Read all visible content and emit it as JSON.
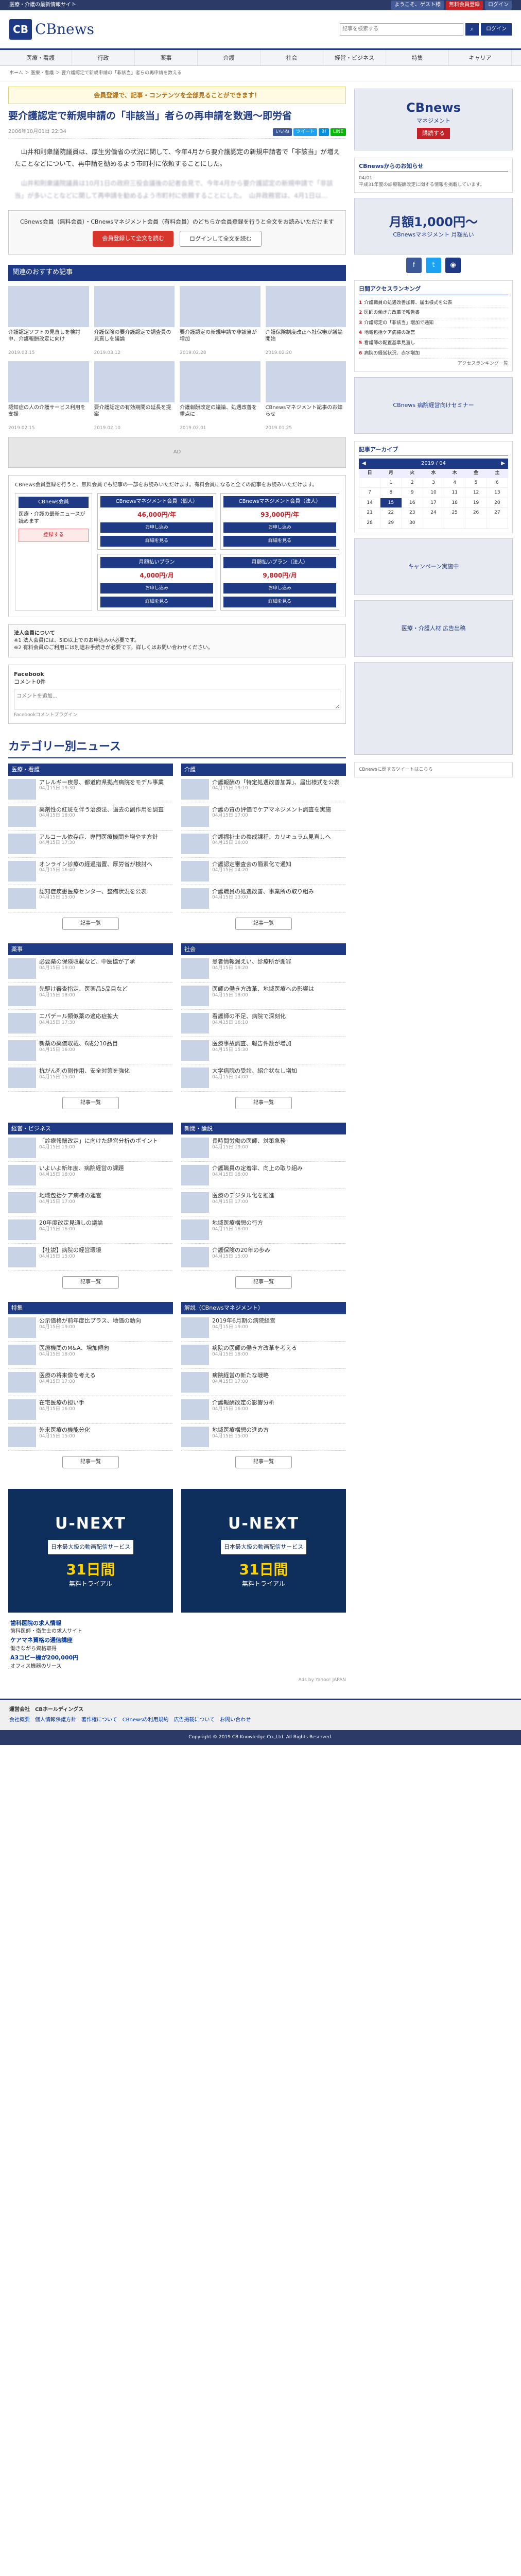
{
  "topbar": {
    "left": "医療・介護の最新情報サイト",
    "links": [
      "ようこそ、ゲスト様",
      "無料会員登録",
      "ログイン"
    ]
  },
  "header": {
    "logo_mark": "CB",
    "logo_text": "CBnews",
    "search_placeholder": "記事を検索する",
    "login_label": "ログイン"
  },
  "gnav": [
    "医療・看護",
    "行政",
    "薬事",
    "介護",
    "社会",
    "経営・ビジネス",
    "特集",
    "キャリア"
  ],
  "breadcrumb": "ホーム ＞ 医療・看護 ＞ 要介護認定で新規申請の「非該当」者らの再申請を数える",
  "banner": "会員登録で、記事・コンテンツを全部見ることができます！",
  "article": {
    "title": "要介護認定で新規申請の「非該当」者らの再申請を数週～即労省",
    "date": "2006年10月01日 22:34",
    "sns": [
      "いいね",
      "ツイート",
      "B!",
      "LINE"
    ],
    "paragraphs": [
      "　山井和則衆議院議員は、厚生労働省の状況に関して、今年4月から要介護認定の新規申請者で「非該当」が増えたことなどについて、再申請を勧めるよう市町村に依頼することにした。",
      "　山井和則衆議院議員は10月1日の政府三役会議後の記者会見で、今年4月から要介護認定の新規申請で「非該当」が多いことなどに関して再申請を勧めるよう市町村に依頼することにした。　山井政務官は、4月1日以…"
    ],
    "register": {
      "note": "CBnews会員（無料会員）・CBnewsマネジメント会員（有料会員）のどちらか会員登録を行うと全文をお読みいただけます",
      "btn1": "会員登録して全文を読む",
      "btn2": "ログインして全文を読む"
    }
  },
  "recommend": {
    "heading": "関連のおすすめ記事",
    "items": [
      {
        "t": "介護認定ソフトの見直しを検討中、介護報酬改定に向け",
        "d": "2019.03.15"
      },
      {
        "t": "介護保険の要介護認定で調査員の見直しを議論",
        "d": "2019.03.12"
      },
      {
        "t": "要介護認定の新規申請で非該当が増加",
        "d": "2019.02.28"
      },
      {
        "t": "介護保険制度改正へ社保審が議論開始",
        "d": "2019.02.20"
      },
      {
        "t": "認知症の人の介護サービス利用を支援",
        "d": "2019.02.15"
      },
      {
        "t": "要介護認定の有効期間の延長を提案",
        "d": "2019.02.10"
      },
      {
        "t": "介護報酬改定の議論、処遇改善を重点に",
        "d": "2019.02.01"
      },
      {
        "t": "CBnewsマネジメント記事のお知らせ",
        "d": "2019.01.25"
      }
    ]
  },
  "plans": {
    "intro": "CBnews会員登録を行うと、無料会員でも記事の一部をお読みいただけます。有料会員になると全ての記事をお読みいただけます。",
    "free": {
      "title": "CBnews会員",
      "note": "医療・介護の最新ニュースが読めます",
      "btn": "登録する"
    },
    "items": [
      {
        "title": "CBnewsマネジメント会員（個人）",
        "price": "46,000円/年",
        "btn": "お申し込み"
      },
      {
        "title": "CBnewsマネジメント会員（法人）",
        "price": "93,000円/年",
        "btn": "お申し込み"
      },
      {
        "title": "月額払いプラン",
        "price": "4,000円/月",
        "btn": "お申し込み"
      },
      {
        "title": "月額払いプラン（法人）",
        "price": "9,800円/月",
        "btn": "お申し込み"
      }
    ],
    "detail_btn": "詳細を見る"
  },
  "notes": {
    "title": "法人会員について",
    "lines": [
      "※1 法人会員には、5ID以上でのお申込みが必要です。",
      "※2 有料会員のご利用には別途お手続きが必要です。詳しくはお問い合わせください。"
    ]
  },
  "facebook": {
    "title": "Facebook",
    "count": "コメント0件",
    "placeholder": "コメントを追加...",
    "plugin": "Facebookコメントプラグイン"
  },
  "categories": {
    "heading": "カテゴリー別ニュース",
    "more": "記事一覧",
    "boxes": [
      {
        "name": "医療・看護",
        "items": [
          {
            "t": "アレルギー疾患、都道府県拠点病院をモデル事業",
            "d": "04月15日 19:30"
          },
          {
            "t": "薬剤性の紅斑を伴う治療法、過去の副作用を調査",
            "d": "04月15日 18:00"
          },
          {
            "t": "アルコール依存症、専門医療機関を増やす方針",
            "d": "04月15日 17:30"
          },
          {
            "t": "オンライン診療の経過措置、厚労省が検討へ",
            "d": "04月15日 16:40"
          },
          {
            "t": "認知症疾患医療センター、整備状況を公表",
            "d": "04月15日 15:00"
          }
        ]
      },
      {
        "name": "介護",
        "items": [
          {
            "t": "介護報酬の「特定処遇改善加算」、届出様式を公表",
            "d": "04月15日 19:10"
          },
          {
            "t": "介護の質の評価でケアマネジメント調査を実施",
            "d": "04月15日 17:00"
          },
          {
            "t": "介護福祉士の養成課程、カリキュラム見直しへ",
            "d": "04月15日 16:00"
          },
          {
            "t": "介護認定審査会の簡素化で通知",
            "d": "04月15日 14:20"
          },
          {
            "t": "介護職員の処遇改善、事業所の取り組み",
            "d": "04月15日 13:00"
          }
        ]
      },
      {
        "name": "薬事",
        "items": [
          {
            "t": "必要薬の保険収載など、中医協が了承",
            "d": "04月15日 19:00"
          },
          {
            "t": "先駆け審査指定、医薬品5品目など",
            "d": "04月15日 18:00"
          },
          {
            "t": "エパデール類似薬の適応症拡大",
            "d": "04月15日 17:30"
          },
          {
            "t": "新薬の薬価収載、6成分10品目",
            "d": "04月15日 16:00"
          },
          {
            "t": "抗がん剤の副作用、安全対策を強化",
            "d": "04月15日 15:00"
          }
        ]
      },
      {
        "name": "社会",
        "items": [
          {
            "t": "患者情報漏えい、診療所が謝罪",
            "d": "04月15日 19:20"
          },
          {
            "t": "医師の働き方改革、地域医療への影響は",
            "d": "04月15日 18:00"
          },
          {
            "t": "看護師の不足、病院で深刻化",
            "d": "04月15日 16:10"
          },
          {
            "t": "医療事故調査、報告件数が増加",
            "d": "04月15日 15:30"
          },
          {
            "t": "大学病院の受診、紹介状なし増加",
            "d": "04月15日 14:00"
          }
        ]
      },
      {
        "name": "経営・ビジネス",
        "items": [
          {
            "t": "「診療報酬改定」に向けた経営分析のポイント",
            "d": "04月15日 19:00"
          },
          {
            "t": "いよいよ新年度、病院経営の課題",
            "d": "04月15日 18:00"
          },
          {
            "t": "地域包括ケア病棟の運営",
            "d": "04月15日 17:00"
          },
          {
            "t": "20年度改定見通しの議論",
            "d": "04月15日 16:00"
          },
          {
            "t": "【社説】病院の経営環境",
            "d": "04月15日 15:00"
          }
        ]
      },
      {
        "name": "新聞・論説",
        "items": [
          {
            "t": "長時間労働の医師、対策急務",
            "d": "04月15日 19:00"
          },
          {
            "t": "介護職員の定着率、向上の取り組み",
            "d": "04月15日 18:00"
          },
          {
            "t": "医療のデジタル化を推進",
            "d": "04月15日 17:00"
          },
          {
            "t": "地域医療構想の行方",
            "d": "04月15日 16:00"
          },
          {
            "t": "介護保険の20年の歩み",
            "d": "04月15日 15:00"
          }
        ]
      },
      {
        "name": "特集",
        "items": [
          {
            "t": "公示価格が前年度比プラス、地価の動向",
            "d": "04月15日 19:00"
          },
          {
            "t": "医療機関のM&A、増加傾向",
            "d": "04月15日 18:00"
          },
          {
            "t": "医療の将来像を考える",
            "d": "04月15日 17:00"
          },
          {
            "t": "在宅医療の担い手",
            "d": "04月15日 16:00"
          },
          {
            "t": "外来医療の機能分化",
            "d": "04月15日 15:00"
          }
        ]
      },
      {
        "name": "解説（CBnewsマネジメント）",
        "items": [
          {
            "t": "2019年6月期の病院経営",
            "d": "04月15日 19:00"
          },
          {
            "t": "病院の医師の働き方改革を考える",
            "d": "04月15日 18:00"
          },
          {
            "t": "病院経営の新たな戦略",
            "d": "04月15日 17:00"
          },
          {
            "t": "介護報酬改定の影響分析",
            "d": "04月15日 16:00"
          },
          {
            "t": "地域医療構想の進め方",
            "d": "04月15日 15:00"
          }
        ]
      }
    ]
  },
  "bottom_ads": {
    "logo": "U-NEXT",
    "sub": "日本最大級の動画配信サービス",
    "days": "31日間",
    "trial": "無料トライアル"
  },
  "text_ads": [
    {
      "t": "歯科医院の求人情報",
      "d": "歯科医師・衛生士の求人サイト"
    },
    {
      "t": "ケアマネ資格の通信講座",
      "d": "働きながら資格取得"
    },
    {
      "t": "A3コピー機が200,000円",
      "d": "オフィス機器のリース"
    }
  ],
  "ads_by": "Ads by Yahoo! JAPAN",
  "side": {
    "ad1": {
      "brand": "CBnews",
      "sub": "マネジメント",
      "cta": "購読する"
    },
    "about": {
      "title": "CBnewsからのお知らせ",
      "date": "04/01",
      "text": "平成31年度の診療報酬改定に関する情報を掲載しています。"
    },
    "ad2": {
      "big": "月額1,000円〜",
      "sub": "CBnewsマネジメント 月額払い"
    },
    "ranking": {
      "title": "日間アクセスランキング",
      "items": [
        "介護職員の処遇改善加算、届出様式を公表",
        "医師の働き方改革で報告書",
        "介護認定の「非該当」増加で通知",
        "地域包括ケア病棟の運営",
        "看護師の配置基準見直し",
        "病院の経営状況、赤字増加"
      ],
      "more": "アクセスランキング一覧"
    },
    "ad3": "CBnews 病院経営向けセミナー",
    "calendar": {
      "title": "記事アーカイブ",
      "month": "2019 / 04",
      "days": [
        "日",
        "月",
        "火",
        "水",
        "木",
        "金",
        "土"
      ],
      "weeks": [
        [
          "",
          "1",
          "2",
          "3",
          "4",
          "5",
          "6"
        ],
        [
          "7",
          "8",
          "9",
          "10",
          "11",
          "12",
          "13"
        ],
        [
          "14",
          "15",
          "16",
          "17",
          "18",
          "19",
          "20"
        ],
        [
          "21",
          "22",
          "23",
          "24",
          "25",
          "26",
          "27"
        ],
        [
          "28",
          "29",
          "30",
          "",
          "",
          "",
          ""
        ]
      ],
      "today": "15"
    },
    "ad4": "キャンペーン実施中",
    "ad5": "医療・介護人材 広告出稿",
    "follow": "CBnewsに関するツイートはこちら"
  },
  "footer": {
    "company": "運営会社　CBホールディングス",
    "links": [
      "会社概要",
      "個人情報保護方針",
      "著作権について",
      "CBnewsの利用規約",
      "広告掲載について",
      "お問い合わせ"
    ],
    "copyright": "Copyright © 2019 CB Knowledge Co.,Ltd. All Rights Reserved."
  }
}
